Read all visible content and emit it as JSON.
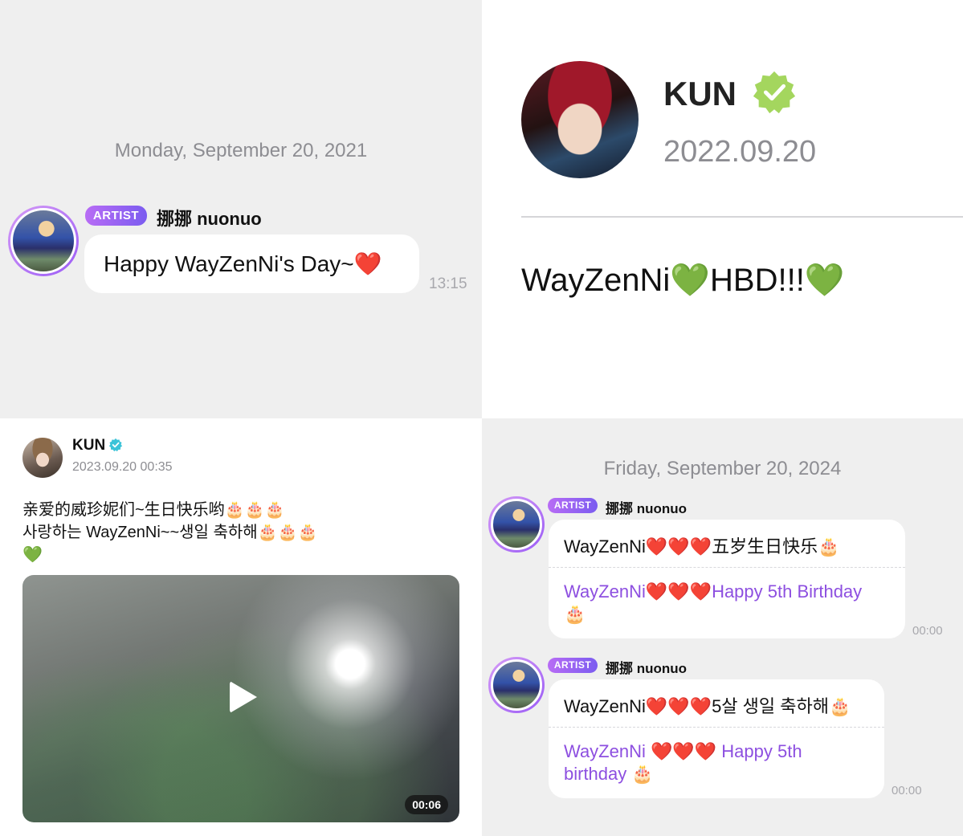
{
  "top_left": {
    "date": "Monday, September 20, 2021",
    "badge": "ARTIST",
    "sender": "挪挪 nuonuo",
    "message": "Happy WayZenNi's Day~",
    "message_emoji": "❤️",
    "time": "13:15"
  },
  "top_right": {
    "name": "KUN",
    "date": "2022.09.20",
    "message_parts": [
      "WayZenNi",
      "💚",
      "HBD!!!",
      "💚"
    ]
  },
  "bottom_left": {
    "name": "KUN",
    "datetime": "2023.09.20 00:35",
    "line1_text": "亲爱的威珍妮们~生日快乐哟",
    "line1_emoji": "🎂🎂🎂",
    "line2_text": "사랑하는 WayZenNi~~생일 축하해",
    "line2_emoji": "🎂🎂🎂",
    "line3_emoji": "💚",
    "video_duration": "00:06"
  },
  "bottom_right": {
    "date": "Friday, September 20, 2024",
    "messages": [
      {
        "badge": "ARTIST",
        "sender": "挪挪 nuonuo",
        "original_name": "WayZenNi",
        "original_hearts": "❤️❤️❤️",
        "original_tail": "五岁生日快乐",
        "original_cake": "🎂",
        "translation_name": "WayZenNi",
        "translation_hearts": "❤️❤️❤️",
        "translation_tail": "Happy 5th Birthday",
        "translation_cake": "🎂",
        "time": "00:00"
      },
      {
        "badge": "ARTIST",
        "sender": "挪挪 nuonuo",
        "original_name": "WayZenNi",
        "original_hearts": "❤️❤️❤️",
        "original_tail": "5살 생일 축하해",
        "original_cake": "🎂",
        "translation_name": "WayZenNi ",
        "translation_hearts": "❤️❤️❤️",
        "translation_tail": " Happy 5th",
        "translation_line2": "birthday ",
        "translation_cake": "🎂",
        "time": "00:00"
      }
    ]
  },
  "colors": {
    "accent_purple": "#8d4fe0",
    "badge_gradient_start": "#b86cf5",
    "badge_gradient_end": "#7b5cf0",
    "verified_green": "#a4d65e",
    "verified_blue": "#3cc3d8",
    "chat_background": "#efefef"
  },
  "icons": [
    "verified-badge-icon",
    "play-icon",
    "heart-emoji",
    "green-heart-emoji",
    "cake-emoji"
  ]
}
